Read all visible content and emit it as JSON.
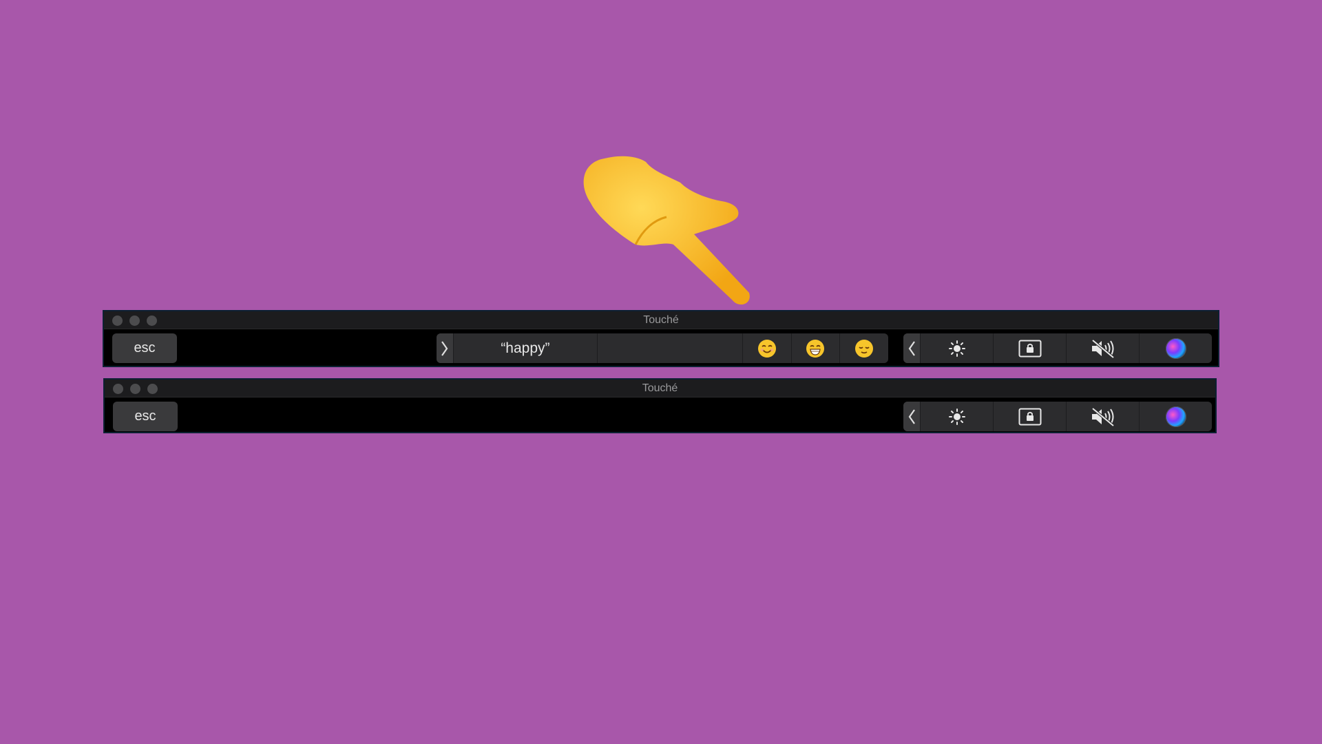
{
  "hand": {
    "icon": "backhand-index-pointing-down-icon",
    "color": "#f7b928"
  },
  "windows": [
    {
      "title": "Touché",
      "esc_label": "esc",
      "suggestions": {
        "expand_icon": "chevron-right-icon",
        "word": "“happy”",
        "emojis": [
          "smiling-face-with-smiling-eyes-icon",
          "grinning-face-icon",
          "relieved-face-icon"
        ]
      },
      "control_strip": {
        "expand_icon": "chevron-left-icon",
        "buttons": [
          "brightness-icon",
          "lock-screen-icon",
          "mute-icon",
          "siri-icon"
        ]
      }
    },
    {
      "title": "Touché",
      "esc_label": "esc",
      "control_strip": {
        "expand_icon": "chevron-left-icon",
        "buttons": [
          "brightness-icon",
          "lock-screen-icon",
          "mute-icon",
          "siri-icon"
        ]
      }
    }
  ],
  "colors": {
    "background": "#a857aa",
    "bar": "#000000",
    "key": "#3a3a3c"
  }
}
